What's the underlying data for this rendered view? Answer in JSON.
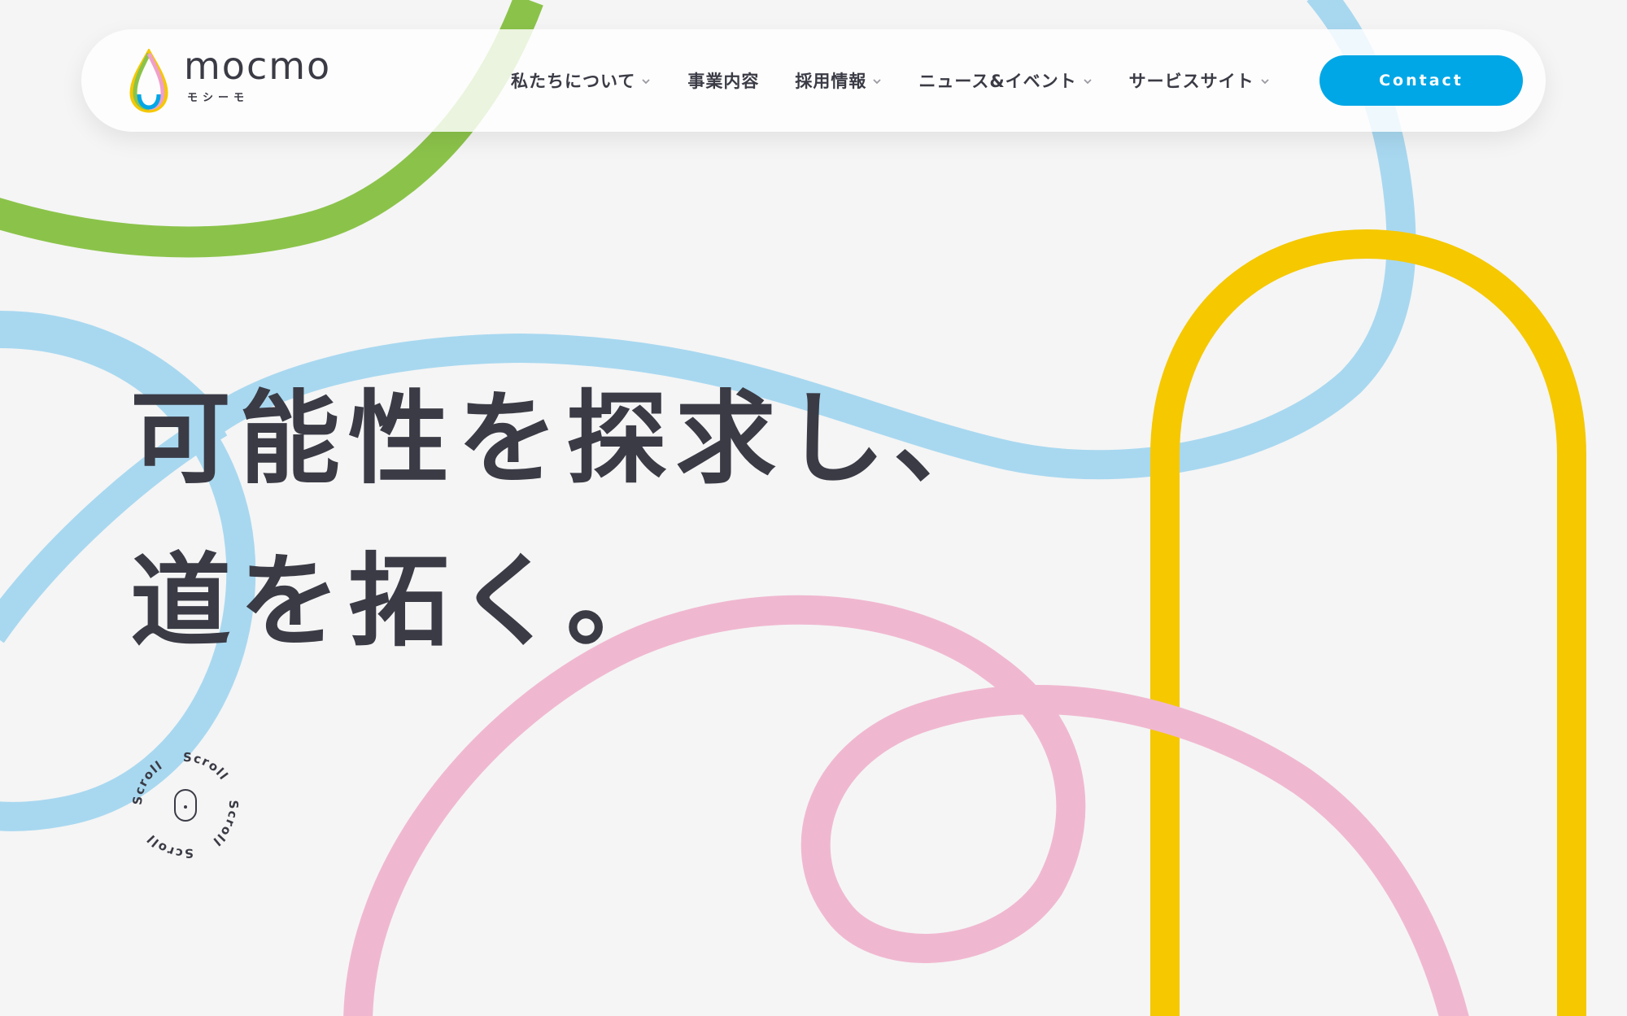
{
  "brand": {
    "name": "mocmo",
    "kana": "モシーモ"
  },
  "nav": {
    "items": [
      {
        "label": "私たちについて",
        "has_dropdown": true
      },
      {
        "label": "事業内容",
        "has_dropdown": false
      },
      {
        "label": "採用情報",
        "has_dropdown": true
      },
      {
        "label": "ニュース&イベント",
        "has_dropdown": true
      },
      {
        "label": "サービスサイト",
        "has_dropdown": true
      }
    ],
    "contact_label": "Contact"
  },
  "hero": {
    "line1": "可能性を探求し、",
    "line2": "道を拓く。"
  },
  "scroll": {
    "label": "Scroll"
  },
  "colors": {
    "background": "#f5f5f5",
    "text": "#3a3b45",
    "accent_blue": "#00a7e6",
    "line_green": "#8bc34a",
    "line_blue": "#a8d8f0",
    "line_yellow": "#f5c800",
    "line_pink": "#f0b8d0"
  },
  "icons": {
    "logo": "water-drop-logo-icon",
    "dropdown": "chevron-down-icon",
    "scroll": "mouse-icon"
  }
}
